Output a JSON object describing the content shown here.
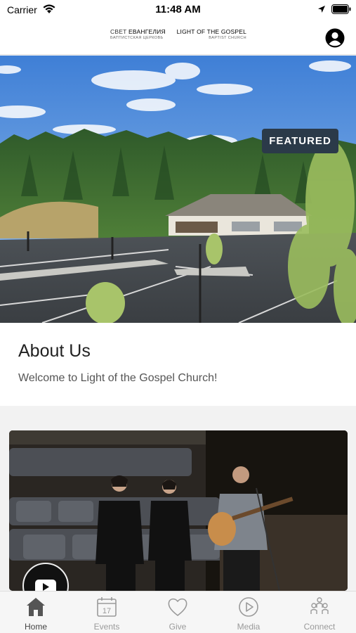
{
  "status_bar": {
    "carrier": "Carrier",
    "time": "11:48 AM"
  },
  "header": {
    "logo": {
      "line1_ru_a": "СВЕТ",
      "line1_ru_b": "ЕВАНГЕЛИЯ",
      "line1_en": "LIGHT OF THE GOSPEL",
      "sub_ru": "БАПТИСТСКАЯ ЦЕРКОВЬ",
      "sub_en": "BAPTIST CHURCH"
    }
  },
  "featured": {
    "badge": "FEATURED"
  },
  "about": {
    "title": "About Us",
    "subtitle": "Welcome to Light of the Gospel Church!"
  },
  "tabs": [
    {
      "label": "Home",
      "icon": "home-icon",
      "active": true
    },
    {
      "label": "Events",
      "icon": "calendar-icon",
      "day": "17"
    },
    {
      "label": "Give",
      "icon": "heart-icon"
    },
    {
      "label": "Media",
      "icon": "play-circle-icon"
    },
    {
      "label": "Connect",
      "icon": "people-icon"
    }
  ],
  "colors": {
    "badge_bg": "#2b3a49",
    "active_tab": "#444444",
    "inactive_tab": "#9a9a9a"
  }
}
